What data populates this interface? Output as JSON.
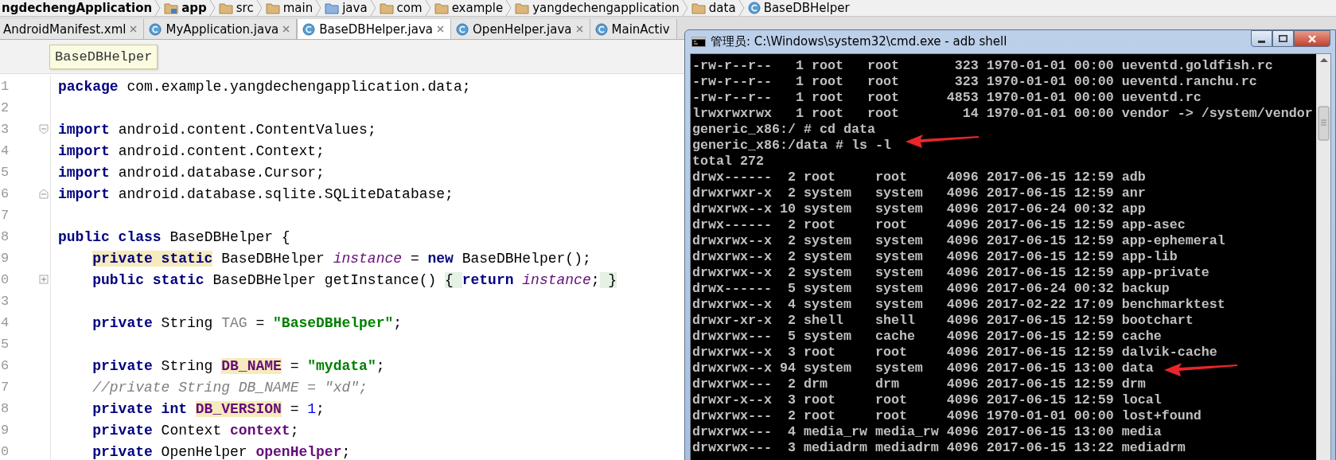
{
  "breadcrumb": [
    {
      "label": "ngdechengApplication",
      "kind": "project"
    },
    {
      "label": "app",
      "kind": "module"
    },
    {
      "label": "src",
      "kind": "folder"
    },
    {
      "label": "main",
      "kind": "folder"
    },
    {
      "label": "java",
      "kind": "source-folder"
    },
    {
      "label": "com",
      "kind": "folder"
    },
    {
      "label": "example",
      "kind": "folder"
    },
    {
      "label": "yangdechengapplication",
      "kind": "folder"
    },
    {
      "label": "data",
      "kind": "folder"
    },
    {
      "label": "BaseDBHelper",
      "kind": "class"
    }
  ],
  "tabs": [
    {
      "label": "AndroidManifest.xml",
      "icon": false,
      "close": true,
      "selected": false
    },
    {
      "label": "MyApplication.java",
      "icon": true,
      "close": true,
      "selected": false
    },
    {
      "label": "BaseDBHelper.java",
      "icon": true,
      "close": true,
      "selected": true
    },
    {
      "label": "OpenHelper.java",
      "icon": true,
      "close": true,
      "selected": false
    },
    {
      "label": "MainActiv",
      "icon": true,
      "close": false,
      "selected": false
    }
  ],
  "editor": {
    "tooltip": "BaseDBHelper",
    "lines": [
      {
        "number": "1",
        "kind": "plain",
        "indented": false,
        "tokens": [
          {
            "text": "package ",
            "kind": "keyword"
          },
          {
            "text": "com.example.yangdechengapplication.data;",
            "kind": "plain"
          }
        ]
      },
      {
        "number": "2",
        "kind": "plain",
        "indented": false
      },
      {
        "number": "3",
        "kind": "opener",
        "indented": false,
        "tokens": [
          {
            "text": "import ",
            "kind": "keyword"
          },
          {
            "text": "android.content.ContentValues;",
            "kind": "plain"
          }
        ]
      },
      {
        "number": "4",
        "kind": "plain",
        "indented": false,
        "tokens": [
          {
            "text": "import ",
            "kind": "keyword"
          },
          {
            "text": "android.content.Context;",
            "kind": "plain"
          }
        ]
      },
      {
        "number": "5",
        "kind": "plain",
        "indented": false,
        "tokens": [
          {
            "text": "import ",
            "kind": "keyword"
          },
          {
            "text": "android.database.Cursor;",
            "kind": "plain"
          }
        ]
      },
      {
        "number": "6",
        "kind": "closer",
        "indented": false,
        "tokens": [
          {
            "text": "import ",
            "kind": "keyword"
          },
          {
            "text": "android.database.sqlite.SQLiteDatabase;",
            "kind": "plain"
          }
        ]
      },
      {
        "number": "7",
        "kind": "plain",
        "indented": false
      },
      {
        "number": "8",
        "kind": "plain",
        "indented": false,
        "tokens": [
          {
            "text": "public class ",
            "kind": "keyword"
          },
          {
            "text": "BaseDBHelper {",
            "kind": "plain"
          }
        ]
      },
      {
        "number": "9",
        "kind": "plain",
        "indented": true,
        "tokens": [
          {
            "text": "private static",
            "kind": "keyword-usage"
          },
          {
            "text": " BaseDBHelper ",
            "kind": "plain"
          },
          {
            "text": "instance",
            "kind": "static-field"
          },
          {
            "text": " = ",
            "kind": "plain"
          },
          {
            "text": "new ",
            "kind": "keyword"
          },
          {
            "text": "BaseDBHelper();",
            "kind": "plain"
          }
        ]
      },
      {
        "number": "0",
        "kind": "folded",
        "indented": true,
        "tokens": [
          {
            "text": "public static ",
            "kind": "keyword"
          },
          {
            "text": "BaseDBHelper getInstance() ",
            "kind": "plain"
          },
          {
            "text": "{ ",
            "kind": "fold-brace"
          },
          {
            "text": "return ",
            "kind": "keyword"
          },
          {
            "text": "instance",
            "kind": "static-field"
          },
          {
            "text": ";",
            "kind": "plain"
          },
          {
            "text": " }",
            "kind": "fold-brace"
          }
        ]
      },
      {
        "number": "3",
        "kind": "plain",
        "indented": false
      },
      {
        "number": "4",
        "kind": "plain",
        "indented": true,
        "tokens": [
          {
            "text": "private ",
            "kind": "keyword"
          },
          {
            "text": "String ",
            "kind": "plain"
          },
          {
            "text": "TAG",
            "kind": "unused"
          },
          {
            "text": " = ",
            "kind": "plain"
          },
          {
            "text": "\"BaseDBHelper\"",
            "kind": "string"
          },
          {
            "text": ";",
            "kind": "plain"
          }
        ]
      },
      {
        "number": "5",
        "kind": "plain",
        "indented": false
      },
      {
        "number": "6",
        "kind": "plain",
        "indented": true,
        "tokens": [
          {
            "text": "private ",
            "kind": "keyword"
          },
          {
            "text": "String ",
            "kind": "plain"
          },
          {
            "text": "DB_NAME",
            "kind": "field-usage"
          },
          {
            "text": " = ",
            "kind": "plain"
          },
          {
            "text": "\"mydata\"",
            "kind": "string"
          },
          {
            "text": ";",
            "kind": "plain"
          }
        ]
      },
      {
        "number": "7",
        "kind": "plain",
        "indented": true,
        "tokens": [
          {
            "text": "//private String DB_NAME = \"xd\";",
            "kind": "comment"
          }
        ]
      },
      {
        "number": "8",
        "kind": "plain",
        "indented": true,
        "tokens": [
          {
            "text": "private int ",
            "kind": "keyword"
          },
          {
            "text": "DB_VERSION",
            "kind": "field-usage"
          },
          {
            "text": " = ",
            "kind": "plain"
          },
          {
            "text": "1",
            "kind": "number"
          },
          {
            "text": ";",
            "kind": "plain"
          }
        ]
      },
      {
        "number": "9",
        "kind": "plain",
        "indented": true,
        "tokens": [
          {
            "text": "private ",
            "kind": "keyword"
          },
          {
            "text": "Context ",
            "kind": "plain"
          },
          {
            "text": "context",
            "kind": "field"
          },
          {
            "text": ";",
            "kind": "plain"
          }
        ]
      },
      {
        "number": "0",
        "kind": "plain",
        "indented": true,
        "tokens": [
          {
            "text": "private ",
            "kind": "keyword"
          },
          {
            "text": "OpenHelper ",
            "kind": "plain"
          },
          {
            "text": "openHelper",
            "kind": "field"
          },
          {
            "text": ";",
            "kind": "plain"
          }
        ]
      }
    ]
  },
  "terminal": {
    "title": "管理员: C:\\Windows\\system32\\cmd.exe - adb  shell",
    "lines": [
      "-rw-r--r--   1 root   root       323 1970-01-01 00:00 ueventd.goldfish.rc",
      "-rw-r--r--   1 root   root       323 1970-01-01 00:00 ueventd.ranchu.rc",
      "-rw-r--r--   1 root   root      4853 1970-01-01 00:00 ueventd.rc",
      "lrwxrwxrwx   1 root   root        14 1970-01-01 00:00 vendor -> /system/vendor",
      "generic_x86:/ # cd data",
      "generic_x86:/data # ls -l",
      "total 272",
      "drwx------  2 root     root     4096 2017-06-15 12:59 adb",
      "drwxrwxr-x  2 system   system   4096 2017-06-15 12:59 anr",
      "drwxrwx--x 10 system   system   4096 2017-06-24 00:32 app",
      "drwx------  2 root     root     4096 2017-06-15 12:59 app-asec",
      "drwxrwx--x  2 system   system   4096 2017-06-15 12:59 app-ephemeral",
      "drwxrwx--x  2 system   system   4096 2017-06-15 12:59 app-lib",
      "drwxrwx--x  2 system   system   4096 2017-06-15 12:59 app-private",
      "drwx------  5 system   system   4096 2017-06-24 00:32 backup",
      "drwxrwx--x  4 system   system   4096 2017-02-22 17:09 benchmarktest",
      "drwxr-xr-x  2 shell    shell    4096 2017-06-15 12:59 bootchart",
      "drwxrwx---  5 system   cache    4096 2017-06-15 12:59 cache",
      "drwxrwx--x  3 root     root     4096 2017-06-15 12:59 dalvik-cache",
      "drwxrwx--x 94 system   system   4096 2017-06-15 13:00 data",
      "drwxrwx---  2 drm      drm      4096 2017-06-15 12:59 drm",
      "drwxr-x--x  3 root     root     4096 2017-06-15 12:59 local",
      "drwxrwx---  2 root     root     4096 1970-01-01 00:00 lost+found",
      "drwxrwx---  4 media_rw media_rw 4096 2017-06-15 13:00 media",
      "drwxrwx---  3 mediadrm mediadrm 4096 2017-06-15 13:22 mediadrm"
    ]
  }
}
